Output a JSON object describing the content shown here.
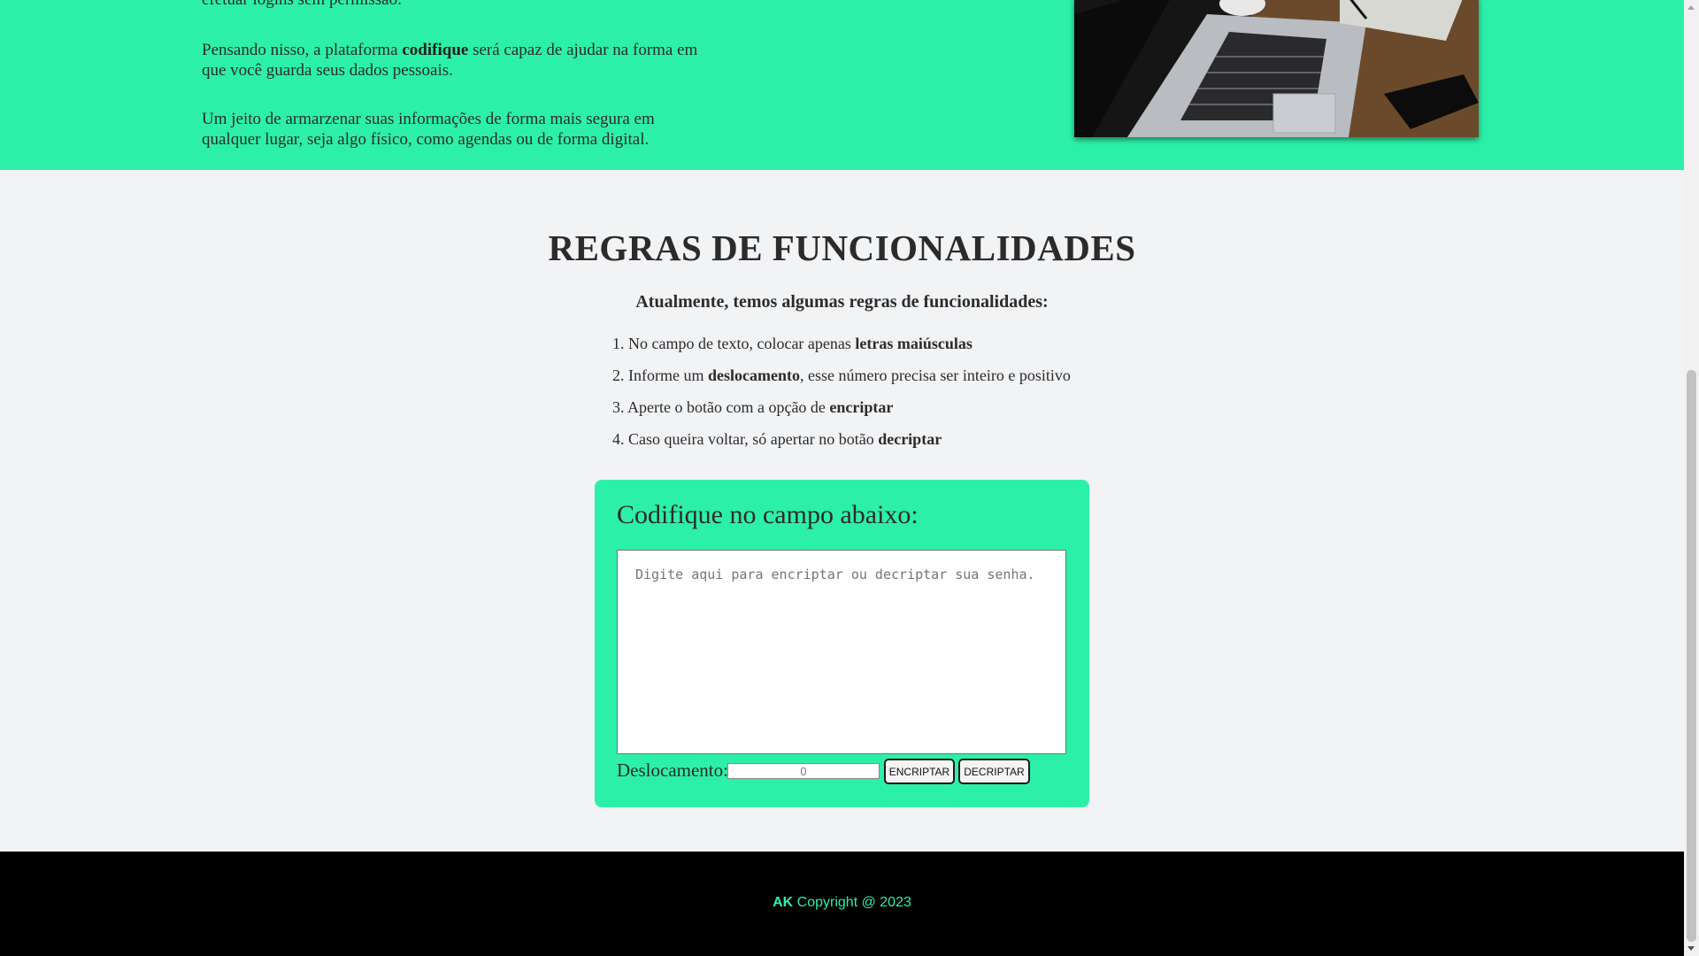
{
  "intro": {
    "line_top_partial": "efetuar logins sem permissão.",
    "p2_before": "Pensando nisso, a plataforma ",
    "p2_bold": "codifique",
    "p2_after": " será capaz de ajudar na forma em que você guarda seus dados pessoais.",
    "p3": "Um jeito de armarzenar suas informações de forma mais segura em qualquer lugar, seja algo físico, como agendas ou de forma digital."
  },
  "rules": {
    "title": "REGRAS DE FUNCIONALIDADES",
    "subtitle": "Atualmente, temos algumas regras de funcionalidades:",
    "items": [
      {
        "before": "1. No campo de texto, colocar apenas ",
        "bold": "letras maiúsculas",
        "after": ""
      },
      {
        "before": "2. Informe um ",
        "bold": "deslocamento",
        "after": ", esse número precisa ser inteiro e positivo"
      },
      {
        "before": "3. Aperte o botão com a opção de ",
        "bold": "encriptar",
        "after": ""
      },
      {
        "before": "4. Caso queira voltar, só apertar no botão ",
        "bold": "decriptar",
        "after": ""
      }
    ]
  },
  "cipher": {
    "title": "Codifique no campo abaixo:",
    "textarea_placeholder": "Digite aqui para encriptar ou decriptar sua senha.",
    "textarea_value": "",
    "offset_label": "Deslocamento:",
    "offset_value": "0",
    "encrypt_label": "ENCRIPTAR",
    "decrypt_label": "DECRIPTAR"
  },
  "footer": {
    "brand": "AK",
    "text": " Copyright @ 2023"
  },
  "colors": {
    "accent": "#2df0a8",
    "background": "#f2f3f5",
    "footer": "#000000"
  }
}
